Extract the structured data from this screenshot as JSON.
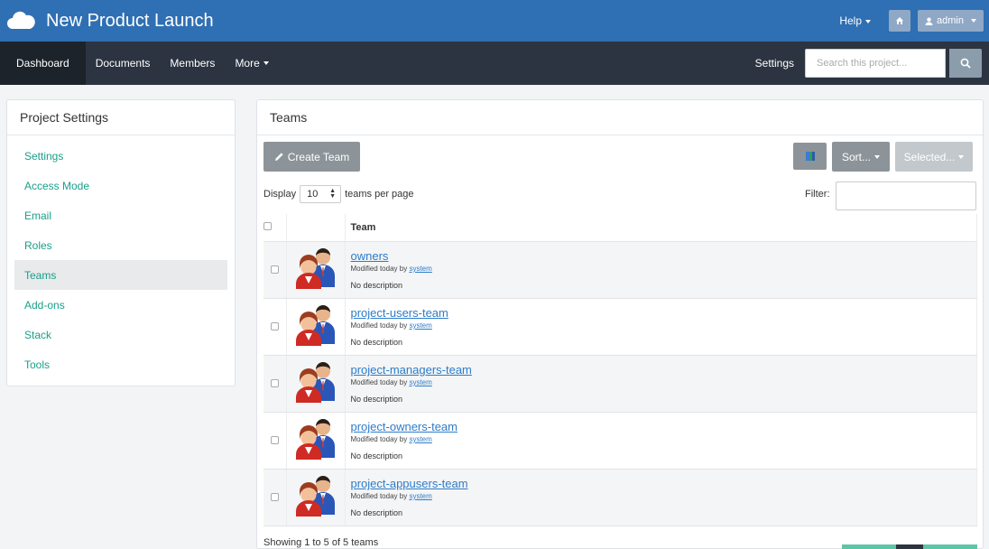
{
  "app": {
    "title": "New Product Launch",
    "help_label": "Help",
    "user_label": "admin"
  },
  "nav": {
    "items": [
      {
        "label": "Dashboard",
        "active": true
      },
      {
        "label": "Documents"
      },
      {
        "label": "Members"
      },
      {
        "label": "More"
      }
    ],
    "settings_label": "Settings",
    "search_placeholder": "Search this project..."
  },
  "sidebar": {
    "title": "Project Settings",
    "items": [
      {
        "label": "Settings"
      },
      {
        "label": "Access Mode"
      },
      {
        "label": "Email"
      },
      {
        "label": "Roles"
      },
      {
        "label": "Teams",
        "active": true
      },
      {
        "label": "Add-ons"
      },
      {
        "label": "Stack"
      },
      {
        "label": "Tools"
      }
    ]
  },
  "main": {
    "title": "Teams",
    "create_label": "Create Team",
    "sort_label": "Sort...",
    "selected_label": "Selected...",
    "display_label": "Display",
    "page_size": "10",
    "per_page_label": "teams per page",
    "filter_label": "Filter:",
    "table_header": "Team",
    "showing": "Showing 1 to 5 of 5 teams"
  },
  "teams": [
    {
      "name": "owners",
      "modified": "Modified today by",
      "modifier": "system",
      "description": "No description"
    },
    {
      "name": "project-users-team",
      "modified": "Modified today by",
      "modifier": "system",
      "description": "No description"
    },
    {
      "name": "project-managers-team",
      "modified": "Modified today by",
      "modifier": "system",
      "description": "No description"
    },
    {
      "name": "project-owners-team",
      "modified": "Modified today by",
      "modifier": "system",
      "description": "No description"
    },
    {
      "name": "project-appusers-team",
      "modified": "Modified today by",
      "modifier": "system",
      "description": "No description"
    }
  ],
  "colors": {
    "topbar": "#2f6fb3",
    "navbar": "#2b3440",
    "link_green": "#19a088",
    "link_blue": "#2d7cc9",
    "button_gray": "#8c9499"
  },
  "icons": {
    "logo": "cloud-logo-icon",
    "home": "home-icon",
    "user": "user-icon",
    "search": "search-icon",
    "create": "pencil-icon",
    "flag": "flag-icon",
    "team": "team-avatar-icon"
  }
}
